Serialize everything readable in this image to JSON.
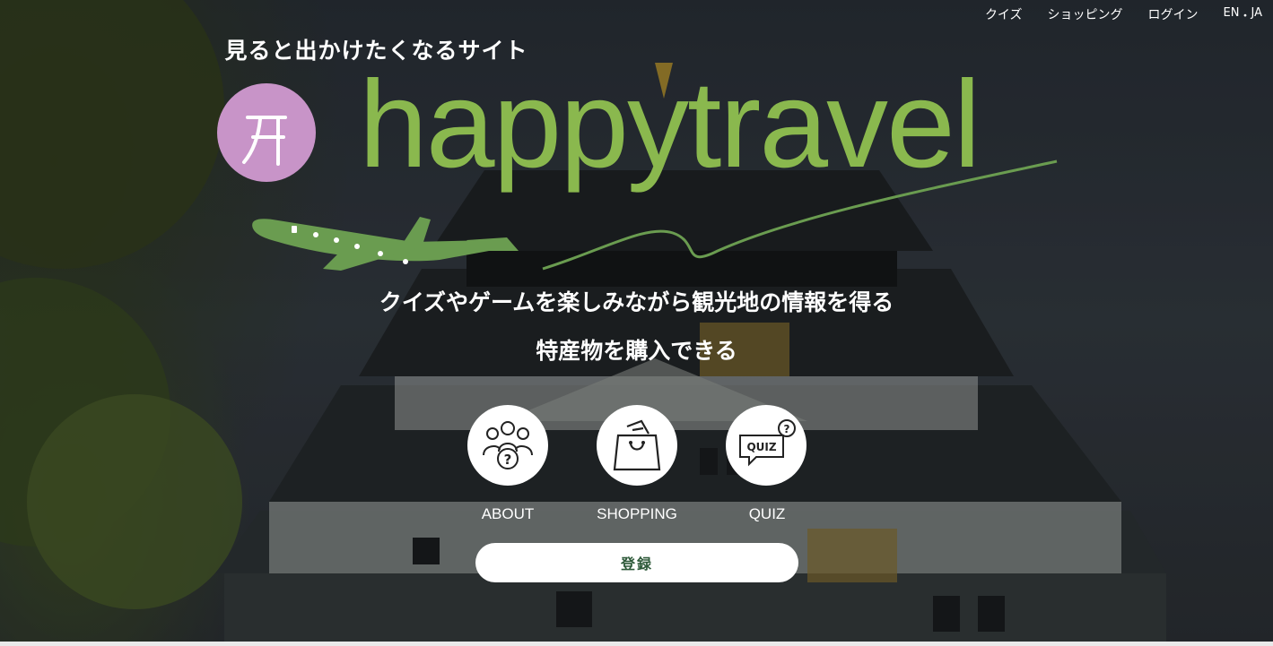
{
  "nav": {
    "quiz": "クイズ",
    "shopping": "ショッピング",
    "login": "ログイン",
    "lang_en": "EN",
    "lang_sep": "・",
    "lang_ja": "JA"
  },
  "hero": {
    "tagline": "見ると出かけたくなるサイト",
    "logo_text": "happytravel",
    "lead_line1": "クイズやゲームを楽しみながら観光地の情報を得る",
    "lead_line2": "特産物を購入できる"
  },
  "features": [
    {
      "label": "ABOUT",
      "icon": "people-question-icon"
    },
    {
      "label": "SHOPPING",
      "icon": "shopping-bag-icon"
    },
    {
      "label": "QUIZ",
      "icon": "quiz-bubble-icon"
    }
  ],
  "register_label": "登録",
  "colors": {
    "logo_green": "#8ab84e",
    "plane_green": "#6a9c50",
    "mark_pink": "#c894c8",
    "button_text": "#2e5a3a"
  }
}
